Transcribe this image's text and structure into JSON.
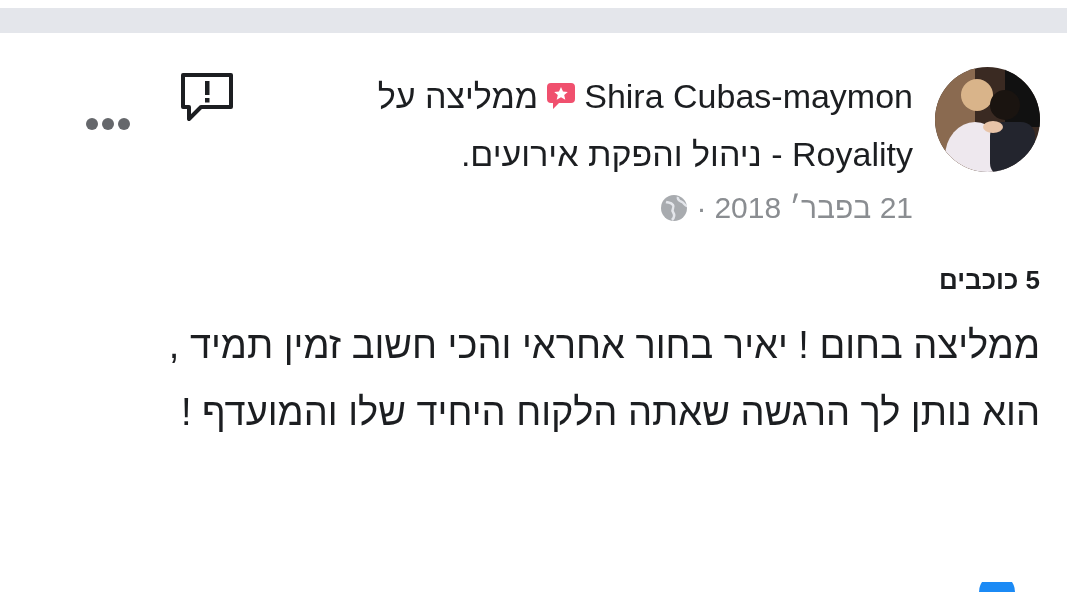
{
  "review": {
    "author": "Shira Cubas-maymon",
    "recommends": true,
    "recommend_text": "ממליצה על",
    "page_name": "Royality - ניהול והפקת אירועים.",
    "date": "21 בפבר׳ 2018",
    "separator": "·",
    "rating_text": "5 כוכבים",
    "body": "ממליצה בחום ! יאיר בחור אחראי והכי חשוב זמין תמיד , הוא נותן לך הרגשה שאתה הלקוח היחיד שלו והמועדף !"
  }
}
